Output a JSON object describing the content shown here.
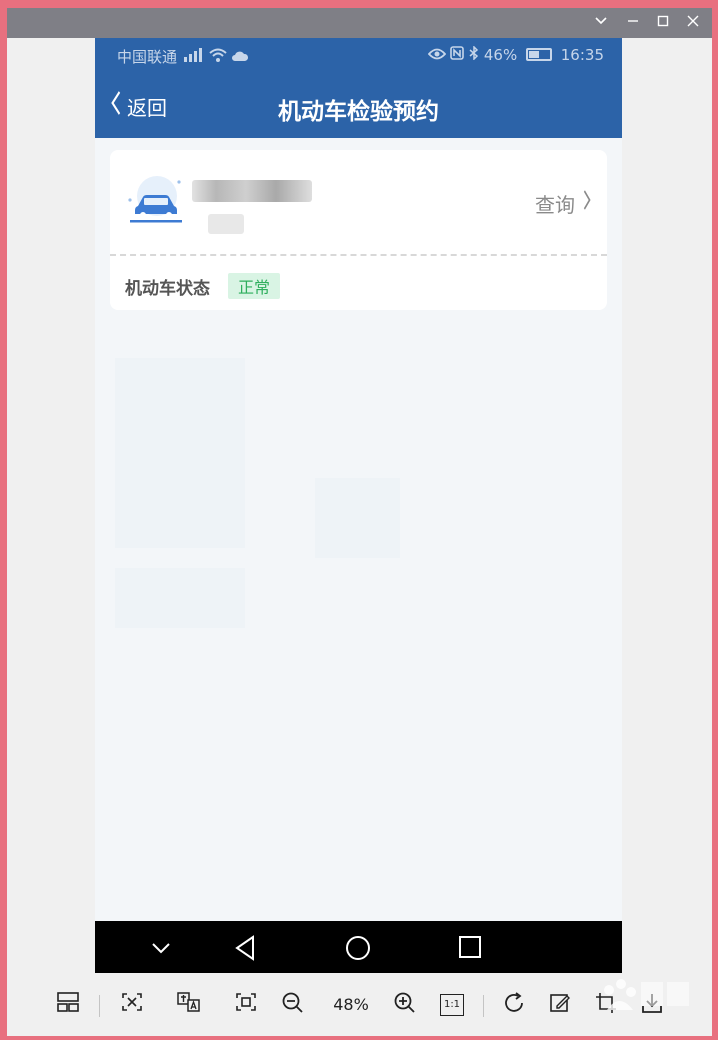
{
  "window": {
    "controls": {
      "dropdown_icon": "chevron-down-icon",
      "minimize_icon": "minimize-icon",
      "maximize_icon": "maximize-icon",
      "close_icon": "close-icon"
    }
  },
  "statusbar": {
    "carrier": "中国联通",
    "battery": "46%",
    "time": "16:35"
  },
  "navbar": {
    "back_label": "返回",
    "title": "机动车检验预约"
  },
  "vehicle_card": {
    "query_label": "查询",
    "status_label": "机动车状态",
    "status_value": "正常"
  },
  "toolbar": {
    "zoom_level": "48%",
    "actual_size_label": "1:1"
  },
  "colors": {
    "header": "#2c63a8",
    "badge_bg": "#d9f4e4",
    "badge_text": "#2fae5d",
    "page_bg": "#f3f6f9"
  }
}
